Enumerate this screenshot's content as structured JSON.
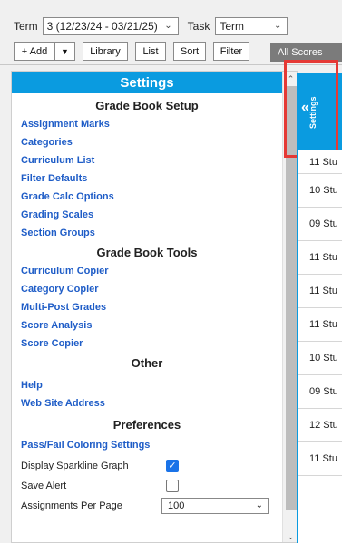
{
  "toolbar": {
    "term_label": "Term",
    "term_value": "3 (12/23/24 - 03/21/25)",
    "task_label": "Task",
    "task_value": "Term",
    "add_label": "+ Add",
    "library_label": "Library",
    "list_label": "List",
    "sort_label": "Sort",
    "filter_label": "Filter",
    "all_scores_label": "All Scores"
  },
  "panel": {
    "title": "Settings",
    "setup_heading": "Grade Book Setup",
    "setup_links": [
      "Assignment Marks",
      "Categories",
      "Curriculum List",
      "Filter Defaults",
      "Grade Calc Options",
      "Grading Scales",
      "Section Groups"
    ],
    "tools_heading": "Grade Book Tools",
    "tools_links": [
      "Curriculum Copier",
      "Category Copier",
      "Multi-Post Grades",
      "Score Analysis",
      "Score Copier"
    ],
    "other_heading": "Other",
    "other_links": [
      "Help",
      "Web Site Address"
    ],
    "prefs_heading": "Preferences",
    "prefs_link": "Pass/Fail Coloring Settings",
    "sparkline_label": "Display Sparkline Graph",
    "sparkline_checked": true,
    "save_alert_label": "Save Alert",
    "save_alert_checked": false,
    "per_page_label": "Assignments Per Page",
    "per_page_value": "100"
  },
  "right": {
    "tab_label": "Settings",
    "rows": [
      "11 Stu",
      "10 Stu",
      "09 Stu",
      "11 Stu",
      "11 Stu",
      "11 Stu",
      "10 Stu",
      "09 Stu",
      "12 Stu",
      "11 Stu"
    ]
  },
  "colors": {
    "accent": "#0a9be0",
    "link": "#1f5dc7",
    "highlight": "#e53935"
  }
}
